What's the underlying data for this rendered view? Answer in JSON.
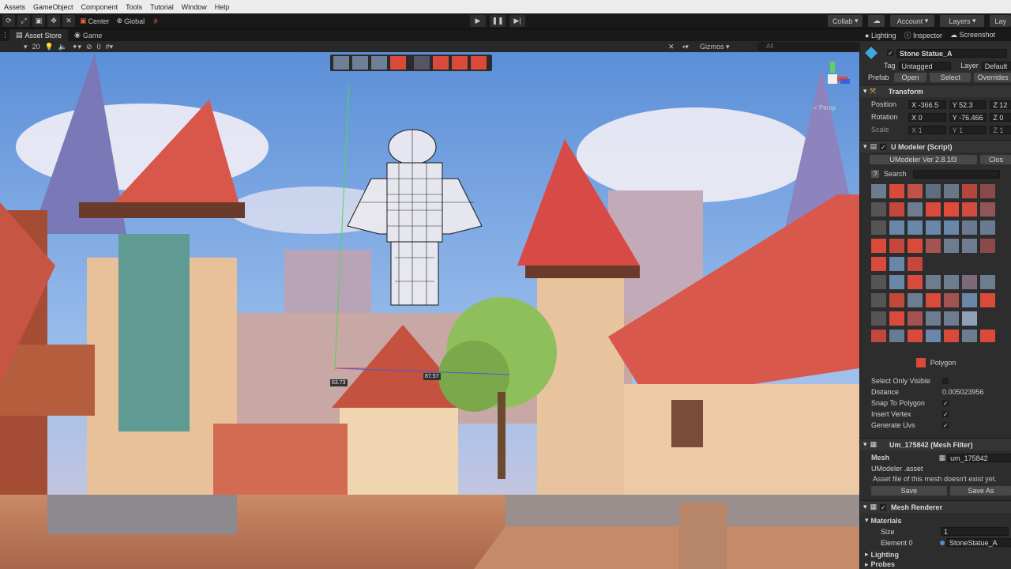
{
  "menu": [
    "Assets",
    "GameObject",
    "Component",
    "Tools",
    "Tutorial",
    "Window",
    "Help"
  ],
  "toolbar": {
    "pivot": "Center",
    "space": "Global",
    "collab": "Collab",
    "account": "Account",
    "layers": "Layers",
    "layout": "Lay"
  },
  "tabs": {
    "asset_store": "Asset Store",
    "game": "Game"
  },
  "scenebar": {
    "layer_count": "20",
    "hidden_count": "0",
    "gizmos": "Gizmos",
    "search_placeholder": "All"
  },
  "viewport": {
    "measure_a": "63.73",
    "measure_b": "87.57",
    "persp_label": "< Persp"
  },
  "inspector": {
    "tabs": [
      "Lighting",
      "Inspector",
      "Screenshot"
    ],
    "object_name": "Stone Statue_A",
    "tag_label": "Tag",
    "tag_value": "Untagged",
    "layer_label": "Layer",
    "layer_value": "Default",
    "prefab_label": "Prefab",
    "prefab_open": "Open",
    "prefab_select": "Select",
    "prefab_overrides": "Overrides",
    "transform": {
      "title": "Transform",
      "position_label": "Position",
      "pos_x": "X -366.5",
      "pos_y": "Y 52.3",
      "pos_z": "Z 12",
      "rotation_label": "Rotation",
      "rot_x": "X 0",
      "rot_y": "Y -76.466",
      "rot_z": "Z 0",
      "scale_label": "Scale",
      "scale_x": "X 1",
      "scale_y": "Y 1",
      "scale_z": "Z 1"
    },
    "umodeler": {
      "title": "U Modeler (Script)",
      "version": "UModeler Ver 2.8.1f3",
      "close": "Clos",
      "search": "Search",
      "mode": "Polygon",
      "select_only_visible": "Select Only Visible",
      "distance_label": "Distance",
      "distance_value": "0.005023956",
      "snap_to_polygon": "Snap To Polygon",
      "insert_vertex": "Insert Vertex",
      "generate_uvs": "Generate Uvs"
    },
    "mesh_filter": {
      "title": "Um_175842 (Mesh Filter)",
      "mesh_label": "Mesh",
      "mesh_value": "um_175842",
      "asset_label": "UModeler .asset",
      "asset_note": "Asset file of this mesh doesn't exist yet.",
      "save": "Save",
      "save_as": "Save As"
    },
    "mesh_renderer": {
      "title": "Mesh Renderer",
      "materials": "Materials",
      "size_label": "Size",
      "size_value": "1",
      "element_label": "Element 0",
      "element_value": "StoneStatue_A",
      "lighting": "Lighting",
      "probes": "Probes"
    }
  },
  "colors": {
    "accent_red": "#e04a3a",
    "ui_dark": "#282828",
    "sky": "#5a9fe0"
  }
}
